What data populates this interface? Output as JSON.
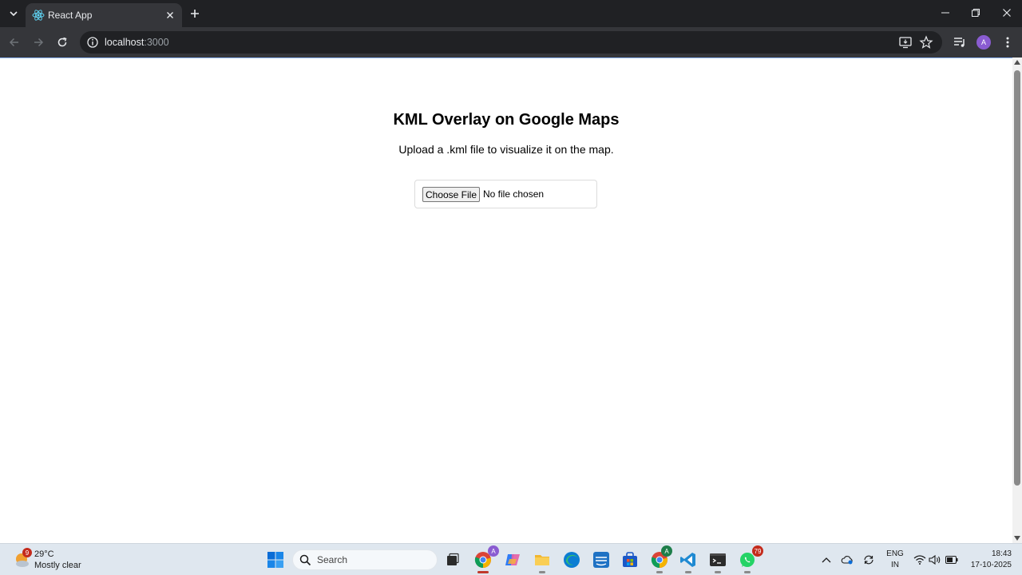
{
  "browser": {
    "tab_title": "React App",
    "url_host": "localhost",
    "url_port": ":3000",
    "profile_initial": "A"
  },
  "page": {
    "title": "KML Overlay on Google Maps",
    "subtitle": "Upload a .kml file to visualize it on the map.",
    "choose_file_label": "Choose File",
    "file_status": "No file chosen"
  },
  "taskbar": {
    "weather_badge": "9",
    "temperature": "29°C",
    "weather_desc": "Mostly clear",
    "search_placeholder": "Search",
    "chrome_profile_badge": "A",
    "chrome2_profile_badge": "A",
    "whatsapp_badge": "79",
    "lang_line1": "ENG",
    "lang_line2": "IN",
    "time": "18:43",
    "date": "17-10-2025"
  }
}
